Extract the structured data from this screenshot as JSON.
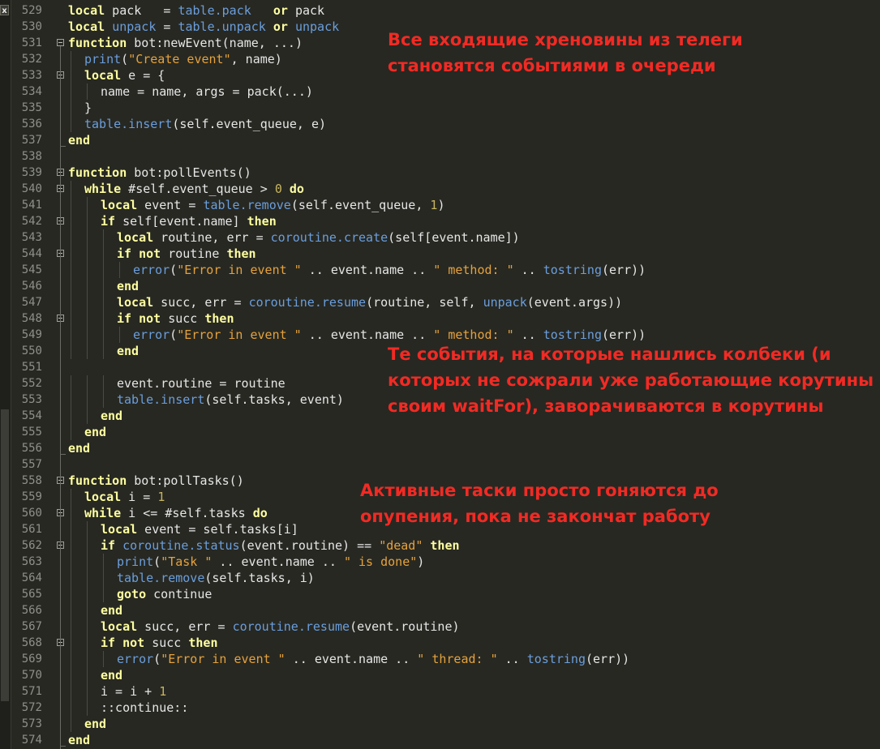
{
  "editor": {
    "close_label": "x",
    "colors": {
      "background": "#272822",
      "keyword": "#ffffa0",
      "library": "#6b9edc",
      "string": "#e6a23c",
      "number": "#c8b560",
      "identifier": "#e6e6e6",
      "annotation": "#f22a24",
      "line_number": "#8f908a"
    },
    "lines": [
      {
        "n": "529",
        "ind": 0,
        "fold": "",
        "t": [
          [
            "kw",
            "local"
          ],
          [
            "id",
            " pack   = "
          ],
          [
            "lib",
            "table.pack"
          ],
          [
            "id",
            "   "
          ],
          [
            "kw",
            "or"
          ],
          [
            "id",
            " pack"
          ]
        ]
      },
      {
        "n": "530",
        "ind": 0,
        "fold": "",
        "t": [
          [
            "kw",
            "local"
          ],
          [
            "id",
            " "
          ],
          [
            "lib",
            "unpack"
          ],
          [
            "id",
            " = "
          ],
          [
            "lib",
            "table.unpack"
          ],
          [
            "id",
            " "
          ],
          [
            "kw",
            "or"
          ],
          [
            "id",
            " "
          ],
          [
            "lib",
            "unpack"
          ]
        ]
      },
      {
        "n": "531",
        "ind": 0,
        "fold": "open",
        "t": [
          [
            "kw",
            "function"
          ],
          [
            "id",
            " bot:newEvent(name, ...)"
          ]
        ]
      },
      {
        "n": "532",
        "ind": 1,
        "fold": "",
        "t": [
          [
            "lib",
            "print"
          ],
          [
            "id",
            "("
          ],
          [
            "str",
            "\"Create event\""
          ],
          [
            "id",
            ", name)"
          ]
        ]
      },
      {
        "n": "533",
        "ind": 1,
        "fold": "open",
        "t": [
          [
            "kw",
            "local"
          ],
          [
            "id",
            " e = {"
          ]
        ]
      },
      {
        "n": "534",
        "ind": 2,
        "fold": "",
        "t": [
          [
            "id",
            "name = name, args = pack(...)"
          ]
        ]
      },
      {
        "n": "535",
        "ind": 1,
        "fold": "",
        "t": [
          [
            "id",
            "}"
          ]
        ]
      },
      {
        "n": "536",
        "ind": 1,
        "fold": "",
        "t": [
          [
            "lib",
            "table.insert"
          ],
          [
            "id",
            "(self.event_queue, e)"
          ]
        ]
      },
      {
        "n": "537",
        "ind": 0,
        "fold": "end",
        "t": [
          [
            "kw",
            "end"
          ]
        ]
      },
      {
        "n": "538",
        "ind": 0,
        "fold": "",
        "t": []
      },
      {
        "n": "539",
        "ind": 0,
        "fold": "open",
        "t": [
          [
            "kw",
            "function"
          ],
          [
            "id",
            " bot:pollEvents()"
          ]
        ]
      },
      {
        "n": "540",
        "ind": 1,
        "fold": "open",
        "t": [
          [
            "kw",
            "while"
          ],
          [
            "id",
            " #self.event_queue > "
          ],
          [
            "num",
            "0"
          ],
          [
            "id",
            " "
          ],
          [
            "kw",
            "do"
          ]
        ]
      },
      {
        "n": "541",
        "ind": 2,
        "fold": "",
        "t": [
          [
            "kw",
            "local"
          ],
          [
            "id",
            " event = "
          ],
          [
            "lib",
            "table.remove"
          ],
          [
            "id",
            "(self.event_queue, "
          ],
          [
            "num",
            "1"
          ],
          [
            "id",
            ")"
          ]
        ]
      },
      {
        "n": "542",
        "ind": 2,
        "fold": "open",
        "t": [
          [
            "kw",
            "if"
          ],
          [
            "id",
            " self[event.name] "
          ],
          [
            "kw",
            "then"
          ]
        ]
      },
      {
        "n": "543",
        "ind": 3,
        "fold": "",
        "t": [
          [
            "kw",
            "local"
          ],
          [
            "id",
            " routine, err = "
          ],
          [
            "lib",
            "coroutine.create"
          ],
          [
            "id",
            "(self[event.name])"
          ]
        ]
      },
      {
        "n": "544",
        "ind": 3,
        "fold": "open",
        "t": [
          [
            "kw",
            "if not"
          ],
          [
            "id",
            " routine "
          ],
          [
            "kw",
            "then"
          ]
        ]
      },
      {
        "n": "545",
        "ind": 4,
        "fold": "",
        "t": [
          [
            "lib",
            "error"
          ],
          [
            "id",
            "("
          ],
          [
            "str",
            "\"Error in event \""
          ],
          [
            "id",
            " .. event.name .. "
          ],
          [
            "str",
            "\" method: \""
          ],
          [
            "id",
            " .. "
          ],
          [
            "lib",
            "tostring"
          ],
          [
            "id",
            "(err))"
          ]
        ]
      },
      {
        "n": "546",
        "ind": 3,
        "fold": "",
        "t": [
          [
            "kw",
            "end"
          ]
        ]
      },
      {
        "n": "547",
        "ind": 3,
        "fold": "",
        "t": [
          [
            "kw",
            "local"
          ],
          [
            "id",
            " succ, err = "
          ],
          [
            "lib",
            "coroutine.resume"
          ],
          [
            "id",
            "(routine, self, "
          ],
          [
            "lib",
            "unpack"
          ],
          [
            "id",
            "(event.args))"
          ]
        ]
      },
      {
        "n": "548",
        "ind": 3,
        "fold": "open",
        "t": [
          [
            "kw",
            "if not"
          ],
          [
            "id",
            " succ "
          ],
          [
            "kw",
            "then"
          ]
        ]
      },
      {
        "n": "549",
        "ind": 4,
        "fold": "",
        "t": [
          [
            "lib",
            "error"
          ],
          [
            "id",
            "("
          ],
          [
            "str",
            "\"Error in event \""
          ],
          [
            "id",
            " .. event.name .. "
          ],
          [
            "str",
            "\" method: \""
          ],
          [
            "id",
            " .. "
          ],
          [
            "lib",
            "tostring"
          ],
          [
            "id",
            "(err))"
          ]
        ]
      },
      {
        "n": "550",
        "ind": 3,
        "fold": "",
        "t": [
          [
            "kw",
            "end"
          ]
        ]
      },
      {
        "n": "551",
        "ind": 0,
        "fold": "",
        "t": []
      },
      {
        "n": "552",
        "ind": 3,
        "fold": "",
        "t": [
          [
            "id",
            "event.routine = routine"
          ]
        ]
      },
      {
        "n": "553",
        "ind": 3,
        "fold": "",
        "t": [
          [
            "lib",
            "table.insert"
          ],
          [
            "id",
            "(self.tasks, event)"
          ]
        ]
      },
      {
        "n": "554",
        "ind": 2,
        "fold": "",
        "t": [
          [
            "kw",
            "end"
          ]
        ]
      },
      {
        "n": "555",
        "ind": 1,
        "fold": "",
        "t": [
          [
            "kw",
            "end"
          ]
        ]
      },
      {
        "n": "556",
        "ind": 0,
        "fold": "end",
        "t": [
          [
            "kw",
            "end"
          ]
        ]
      },
      {
        "n": "557",
        "ind": 0,
        "fold": "",
        "t": []
      },
      {
        "n": "558",
        "ind": 0,
        "fold": "open",
        "t": [
          [
            "kw",
            "function"
          ],
          [
            "id",
            " bot:pollTasks()"
          ]
        ]
      },
      {
        "n": "559",
        "ind": 1,
        "fold": "",
        "t": [
          [
            "kw",
            "local"
          ],
          [
            "id",
            " i = "
          ],
          [
            "num",
            "1"
          ]
        ]
      },
      {
        "n": "560",
        "ind": 1,
        "fold": "open",
        "t": [
          [
            "kw",
            "while"
          ],
          [
            "id",
            " i <= #self.tasks "
          ],
          [
            "kw",
            "do"
          ]
        ]
      },
      {
        "n": "561",
        "ind": 2,
        "fold": "",
        "t": [
          [
            "kw",
            "local"
          ],
          [
            "id",
            " event = self.tasks[i]"
          ]
        ]
      },
      {
        "n": "562",
        "ind": 2,
        "fold": "open",
        "t": [
          [
            "kw",
            "if"
          ],
          [
            "id",
            " "
          ],
          [
            "lib",
            "coroutine.status"
          ],
          [
            "id",
            "(event.routine) == "
          ],
          [
            "str",
            "\"dead\""
          ],
          [
            "id",
            " "
          ],
          [
            "kw",
            "then"
          ]
        ]
      },
      {
        "n": "563",
        "ind": 3,
        "fold": "",
        "t": [
          [
            "lib",
            "print"
          ],
          [
            "id",
            "("
          ],
          [
            "str",
            "\"Task \""
          ],
          [
            "id",
            " .. event.name .. "
          ],
          [
            "str",
            "\" is done\""
          ],
          [
            "id",
            ")"
          ]
        ]
      },
      {
        "n": "564",
        "ind": 3,
        "fold": "",
        "t": [
          [
            "lib",
            "table.remove"
          ],
          [
            "id",
            "(self.tasks, i)"
          ]
        ]
      },
      {
        "n": "565",
        "ind": 3,
        "fold": "",
        "t": [
          [
            "kw",
            "goto"
          ],
          [
            "id",
            " continue"
          ]
        ]
      },
      {
        "n": "566",
        "ind": 2,
        "fold": "",
        "t": [
          [
            "kw",
            "end"
          ]
        ]
      },
      {
        "n": "567",
        "ind": 2,
        "fold": "",
        "t": [
          [
            "kw",
            "local"
          ],
          [
            "id",
            " succ, err = "
          ],
          [
            "lib",
            "coroutine.resume"
          ],
          [
            "id",
            "(event.routine)"
          ]
        ]
      },
      {
        "n": "568",
        "ind": 2,
        "fold": "open",
        "t": [
          [
            "kw",
            "if not"
          ],
          [
            "id",
            " succ "
          ],
          [
            "kw",
            "then"
          ]
        ]
      },
      {
        "n": "569",
        "ind": 3,
        "fold": "",
        "t": [
          [
            "lib",
            "error"
          ],
          [
            "id",
            "("
          ],
          [
            "str",
            "\"Error in event \""
          ],
          [
            "id",
            " .. event.name .. "
          ],
          [
            "str",
            "\" thread: \""
          ],
          [
            "id",
            " .. "
          ],
          [
            "lib",
            "tostring"
          ],
          [
            "id",
            "(err))"
          ]
        ]
      },
      {
        "n": "570",
        "ind": 2,
        "fold": "",
        "t": [
          [
            "kw",
            "end"
          ]
        ]
      },
      {
        "n": "571",
        "ind": 2,
        "fold": "",
        "t": [
          [
            "id",
            "i = i + "
          ],
          [
            "num",
            "1"
          ]
        ]
      },
      {
        "n": "572",
        "ind": 2,
        "fold": "",
        "t": [
          [
            "id",
            "::continue::"
          ]
        ]
      },
      {
        "n": "573",
        "ind": 1,
        "fold": "",
        "t": [
          [
            "kw",
            "end"
          ]
        ]
      },
      {
        "n": "574",
        "ind": 0,
        "fold": "end",
        "t": [
          [
            "kw",
            "end"
          ]
        ]
      }
    ]
  },
  "annotations": [
    {
      "text": "Все входящие хреновины из телеги\nстановятся событиями в очереди"
    },
    {
      "text": "Те события, на которые нашлись колбеки (и\nкоторых не сожрали уже работающие корутины\nсвоим waitFor), заворачиваются в корутины"
    },
    {
      "text": "Активные таски просто гоняются до\nопупения, пока не закончат работу"
    }
  ]
}
